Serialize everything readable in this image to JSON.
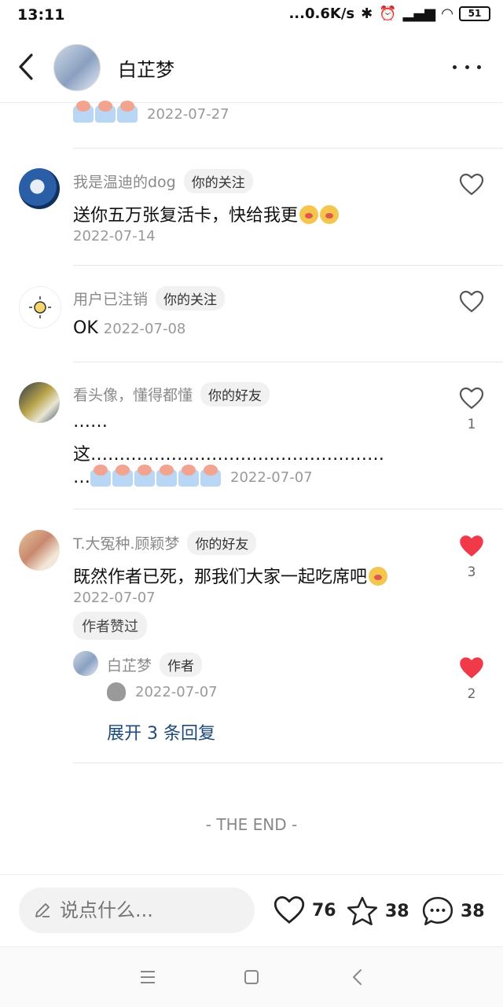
{
  "status_bar": {
    "time": "13:11",
    "network_speed": "...0.6K/s",
    "battery": "51"
  },
  "header": {
    "title": "白芷梦"
  },
  "comments": [
    {
      "date": "2022-07-27"
    },
    {
      "name": "我是温迪的dog",
      "tag": "你的关注",
      "text": "送你五万张复活卡，快给我更",
      "date": "2022-07-14"
    },
    {
      "name": "用户已注销",
      "tag": "你的关注",
      "text": "OK",
      "date": "2022-07-08"
    },
    {
      "name": "看头像，懂得都懂",
      "tag": "你的好友",
      "line1": "……",
      "line2": "这……………………………………………",
      "line3": "…",
      "date": "2022-07-07",
      "likes": "1"
    },
    {
      "name": "T.大冤种.顾颖梦",
      "tag": "你的好友",
      "text": "既然作者已死，那我们大家一起吃席吧",
      "date": "2022-07-07",
      "badge": "作者赞过",
      "likes": "3",
      "reply": {
        "name": "白芷梦",
        "tag": "作者",
        "date": "2022-07-07",
        "likes": "2",
        "expand": "展开 3 条回复"
      }
    }
  ],
  "end_text": "- THE END -",
  "bottom_bar": {
    "placeholder": "说点什么...",
    "likes": "76",
    "favorites": "38",
    "comments": "38"
  },
  "colors": {
    "liked": "#f03a4a",
    "link": "#1e4a7a"
  }
}
